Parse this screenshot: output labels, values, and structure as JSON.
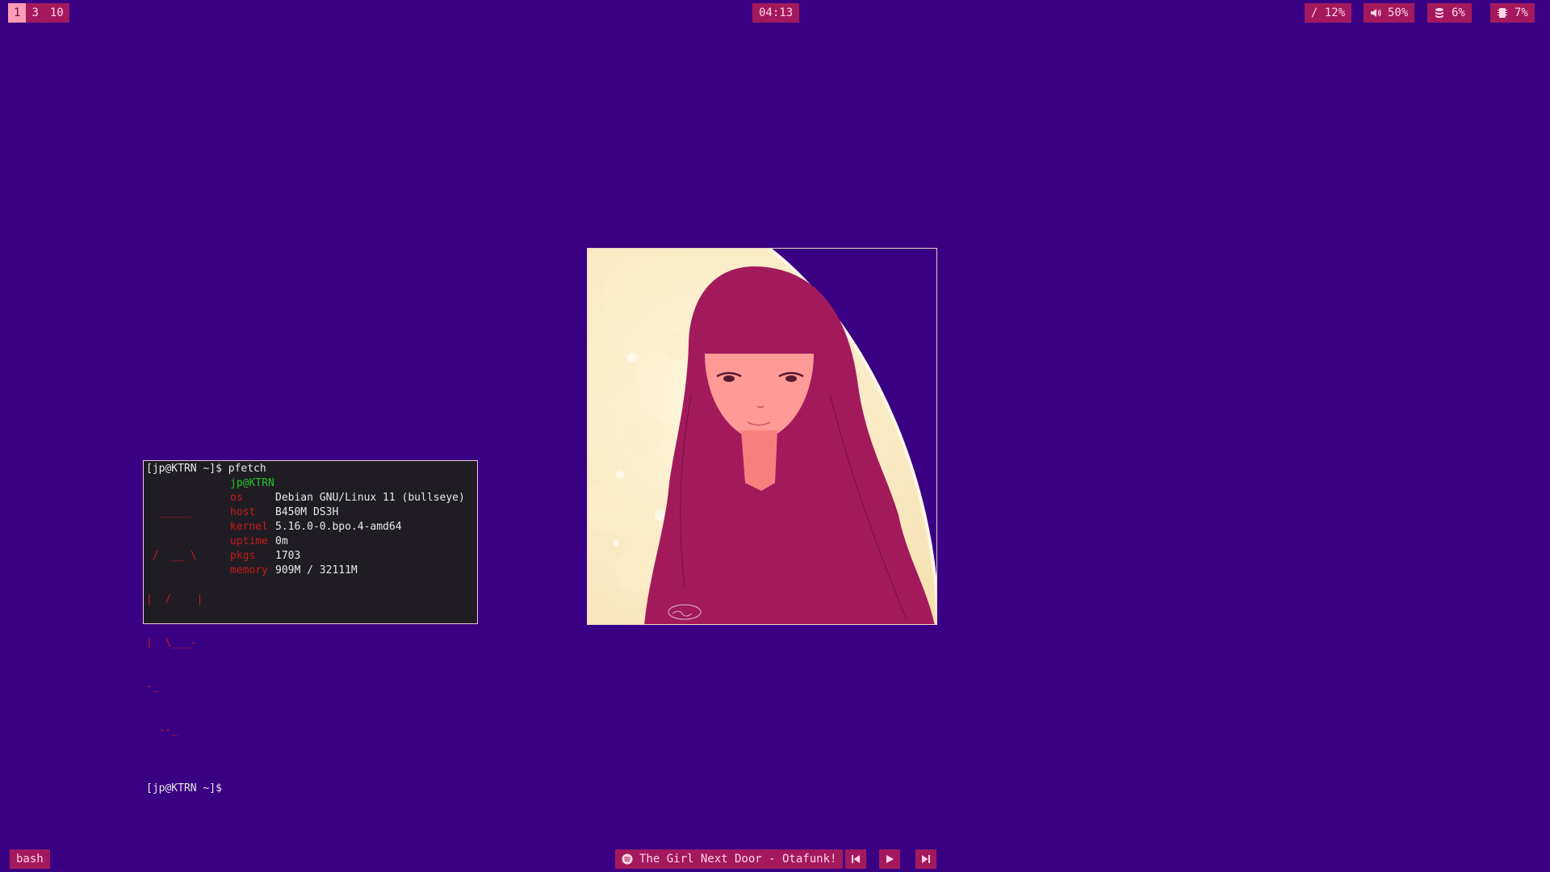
{
  "workspaces": [
    {
      "label": "1",
      "active": true
    },
    {
      "label": "3",
      "active": false
    },
    {
      "label": "10",
      "active": false
    }
  ],
  "clock": "04:13",
  "status": {
    "disk": "/ 12%",
    "volume": "50%",
    "memory": "6%",
    "cpu": "7%"
  },
  "terminal": {
    "prompt1": "[jp@KTRN ~]$ pfetch",
    "logo": [
      "  _____",
      " /  __ \\",
      "|  /    |",
      "|  \\___-",
      "-_",
      "  --_"
    ],
    "userhost": "jp@KTRN",
    "info": [
      {
        "key": "os",
        "value": "Debian GNU/Linux 11 (bullseye)"
      },
      {
        "key": "host",
        "value": "B450M DS3H"
      },
      {
        "key": "kernel",
        "value": "5.16.0-0.bpo.4-amd64"
      },
      {
        "key": "uptime",
        "value": "0m"
      },
      {
        "key": "pkgs",
        "value": "1703"
      },
      {
        "key": "memory",
        "value": "909M / 32111M"
      }
    ],
    "prompt2": "[jp@KTRN ~]$"
  },
  "bottom": {
    "shell": "bash",
    "song": "The Girl Next Door - Otafunk!"
  },
  "colors": {
    "background": "#3a0083",
    "pill": "#a4195e",
    "active_workspace": "#ff9cb5",
    "terminal_bg": "#1f1d23"
  },
  "icons": [
    "volume-icon",
    "database-icon",
    "memory-chip-icon",
    "spotify-icon",
    "skip-previous-icon",
    "play-icon",
    "skip-next-icon"
  ]
}
